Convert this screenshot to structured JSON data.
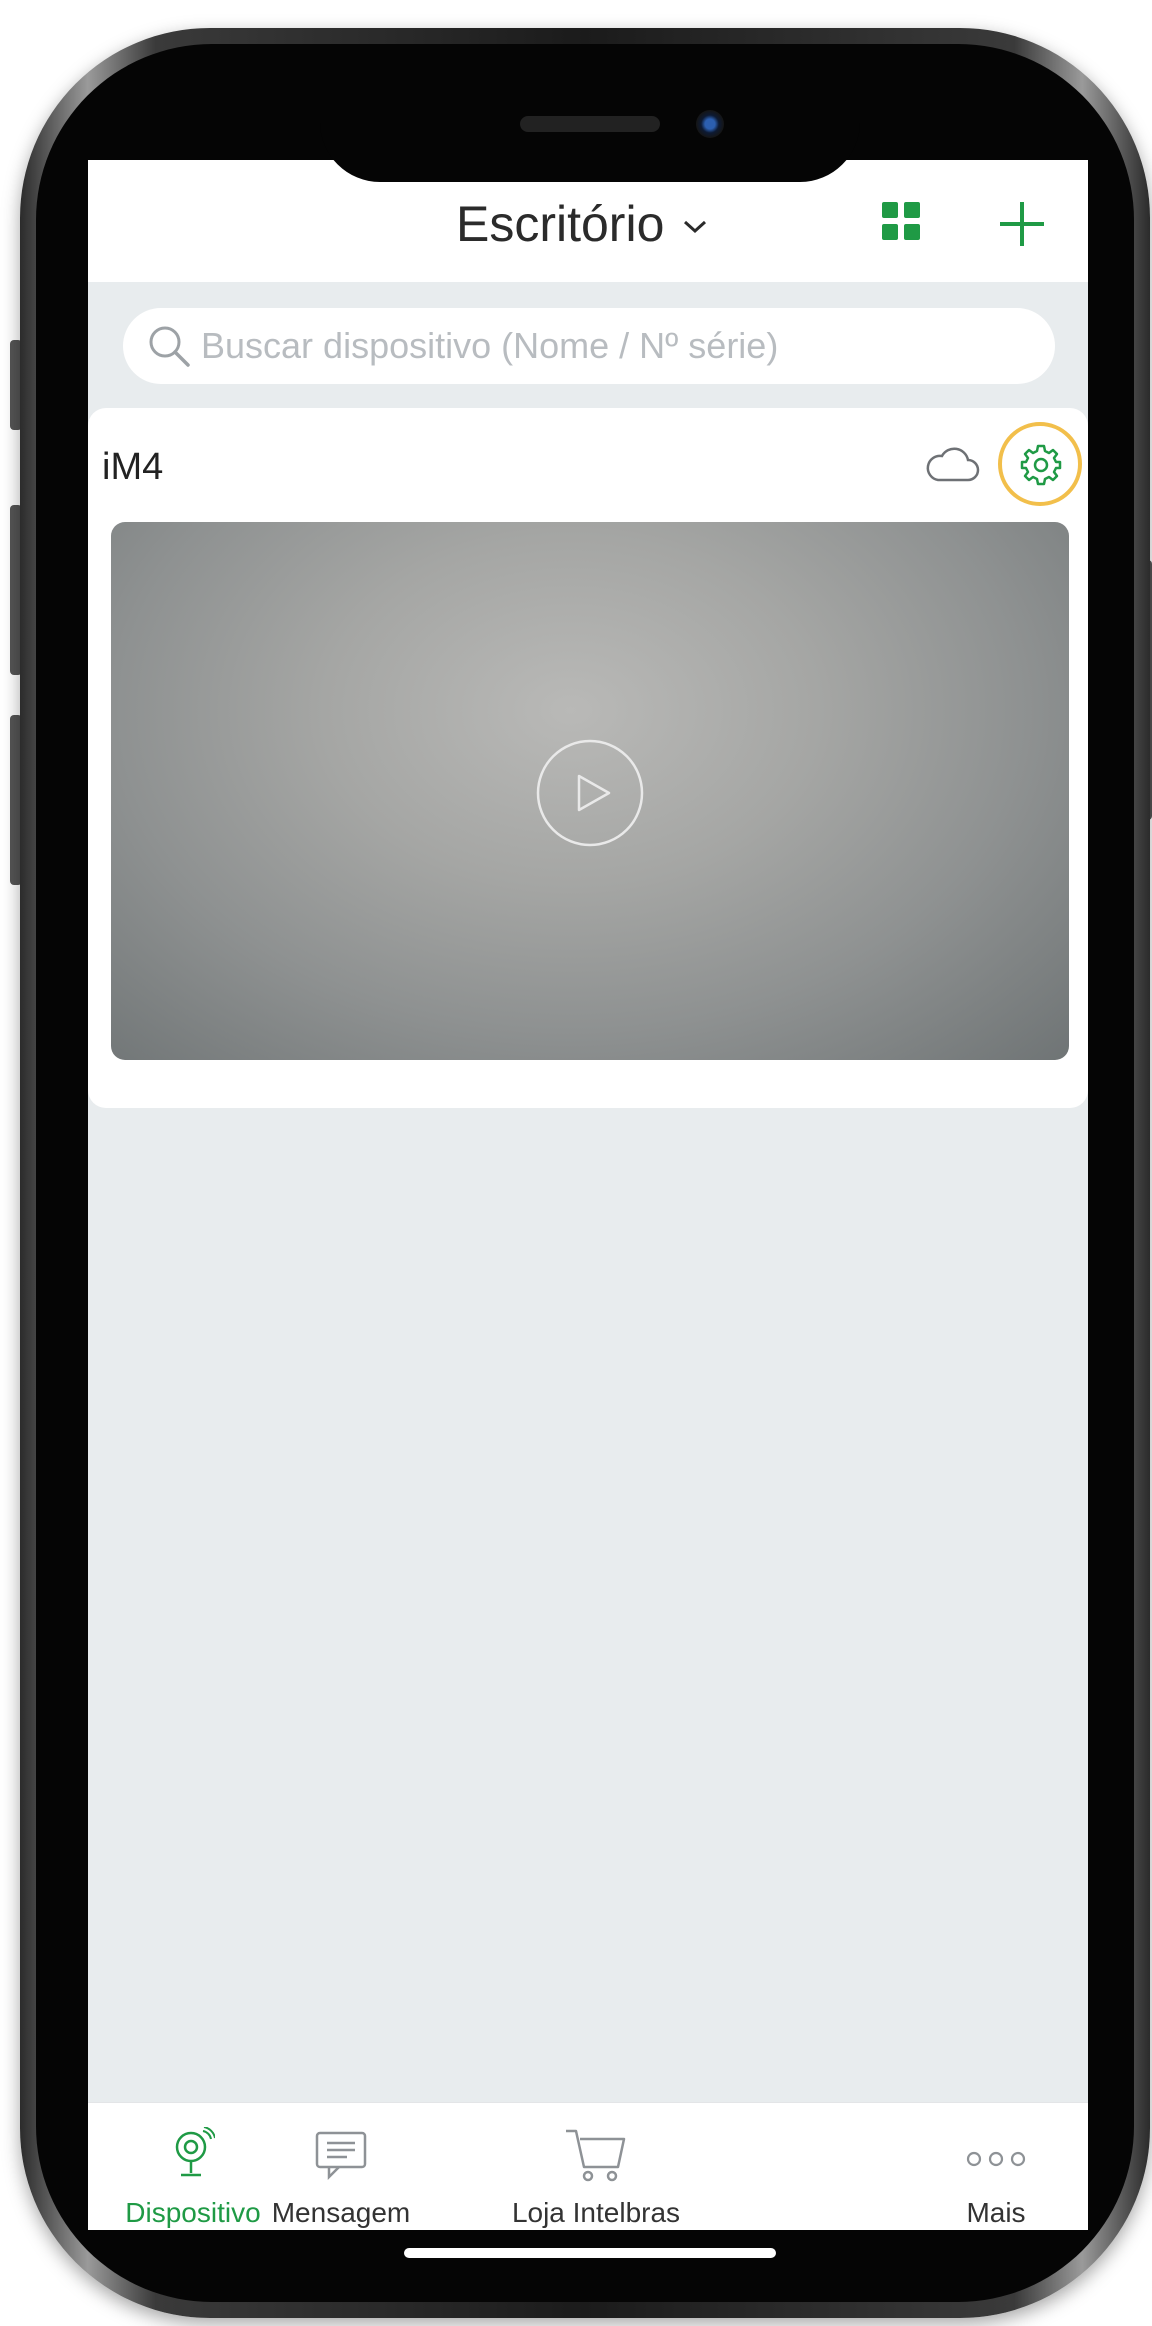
{
  "header": {
    "title": "Escritório",
    "title_icon": "chevron-down-icon",
    "layout_icon": "grid-icon",
    "add_icon": "plus-icon",
    "accent_color": "#1f9a45"
  },
  "search": {
    "placeholder": "Buscar dispositivo (Nome / Nº série)",
    "icon": "search-icon"
  },
  "devices": [
    {
      "name": "iM4",
      "cloud_icon": "cloud-icon",
      "settings_icon": "gear-icon",
      "highlight_color": "#f2bf4b",
      "preview_icon": "play-icon"
    }
  ],
  "tabs": [
    {
      "label": "Dispositivo",
      "icon": "camera-icon",
      "active": true
    },
    {
      "label": "Mensagem",
      "icon": "message-icon",
      "active": false
    },
    {
      "label": "Loja Intelbras",
      "icon": "cart-icon",
      "active": false
    },
    {
      "label": "Mais",
      "icon": "more-icon",
      "active": false
    }
  ]
}
